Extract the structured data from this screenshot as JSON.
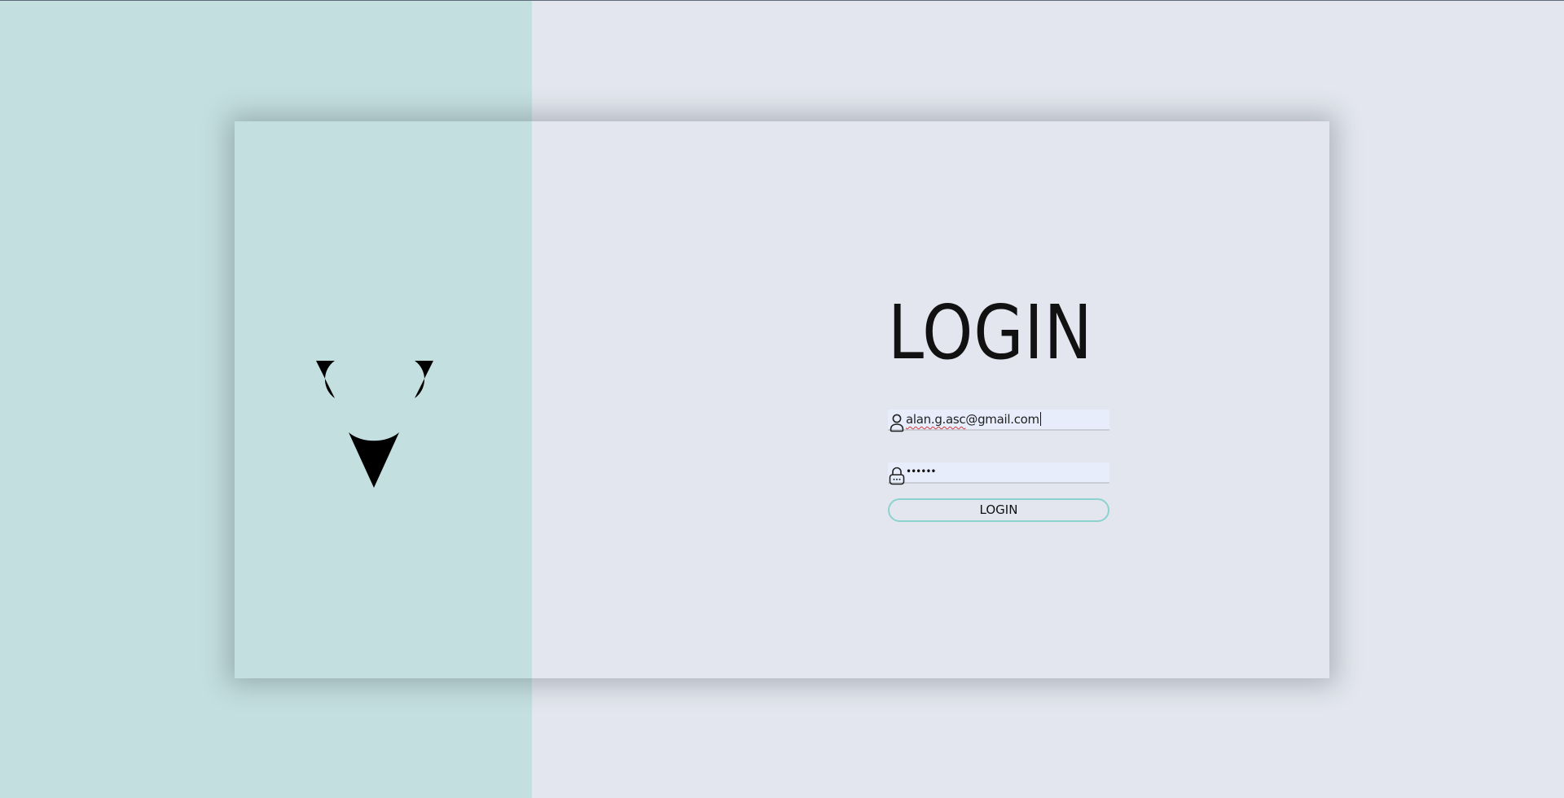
{
  "login_form": {
    "title": "LOGIN",
    "email": {
      "value_prefix": "alan.g.asc",
      "value_suffix": "@gmail.com",
      "icon": "user-icon"
    },
    "password": {
      "masked_value": "••••••",
      "icon": "lock-icon"
    },
    "submit_label": "LOGIN"
  },
  "colors": {
    "background": "#e3e6ee",
    "teal_panel": "#c4dfe0",
    "field_background": "#e8edfb",
    "button_border": "#8cd3cf"
  }
}
